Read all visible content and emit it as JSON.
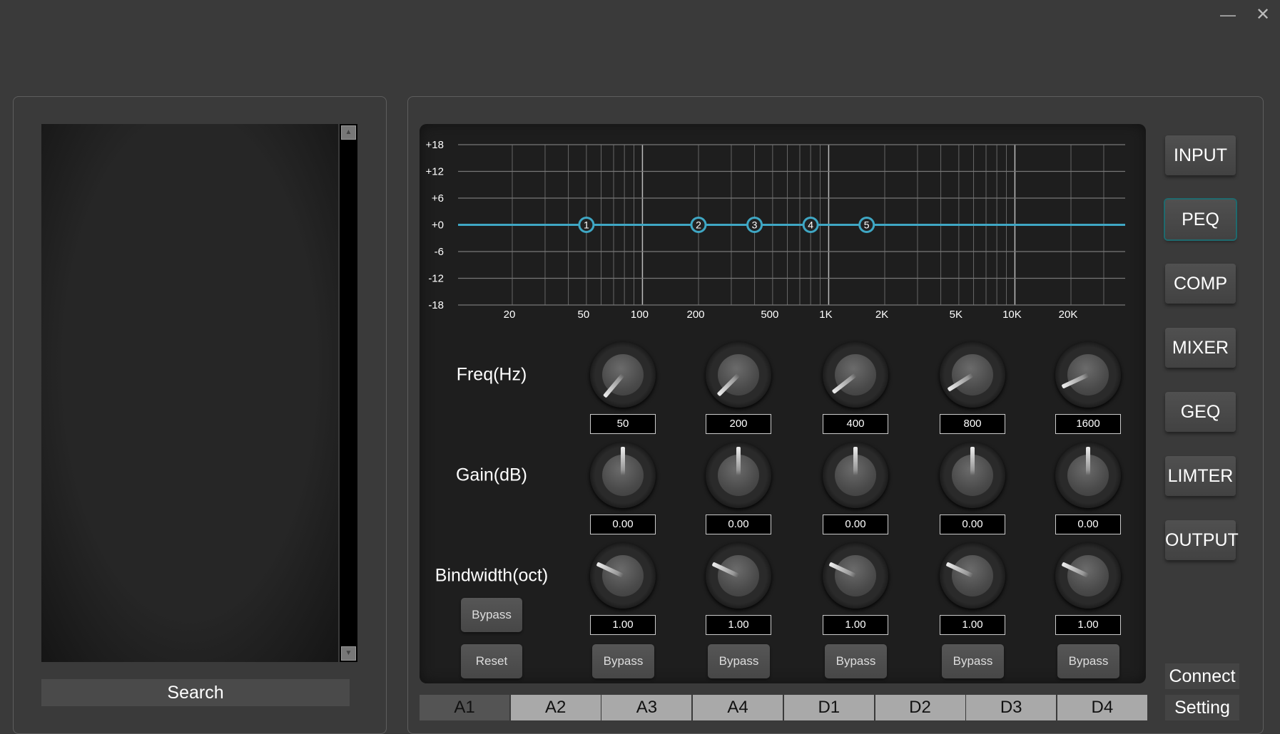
{
  "window": {
    "minimize_icon": "minimize-icon",
    "close_icon": "close-icon"
  },
  "left": {
    "search_label": "Search"
  },
  "eq": {
    "row_labels": {
      "freq": "Freq(Hz)",
      "gain": "Gain(dB)",
      "bandwidth": "Bindwidth(oct)"
    },
    "global_bypass": "Bypass",
    "reset": "Reset",
    "bands": [
      {
        "freq": "50",
        "gain": "0.00",
        "bw": "1.00",
        "bypass": "Bypass"
      },
      {
        "freq": "200",
        "gain": "0.00",
        "bw": "1.00",
        "bypass": "Bypass"
      },
      {
        "freq": "400",
        "gain": "0.00",
        "bw": "1.00",
        "bypass": "Bypass"
      },
      {
        "freq": "800",
        "gain": "0.00",
        "bw": "1.00",
        "bypass": "Bypass"
      },
      {
        "freq": "1600",
        "gain": "0.00",
        "bw": "1.00",
        "bypass": "Bypass"
      }
    ]
  },
  "nav": [
    {
      "label": "INPUT"
    },
    {
      "label": "PEQ",
      "active": true
    },
    {
      "label": "COMP"
    },
    {
      "label": "MIXER"
    },
    {
      "label": "GEQ"
    },
    {
      "label": "LIMTER"
    },
    {
      "label": "OUTPUT"
    }
  ],
  "footer": {
    "connect": "Connect",
    "setting": "Setting"
  },
  "channels": [
    {
      "label": "A1",
      "active": true
    },
    {
      "label": "A2"
    },
    {
      "label": "A3"
    },
    {
      "label": "A4"
    },
    {
      "label": "D1"
    },
    {
      "label": "D2"
    },
    {
      "label": "D3"
    },
    {
      "label": "D4"
    }
  ],
  "colors": {
    "curve": "#3fa7c4",
    "grid": "#777777",
    "accent": "#1f6a6e"
  },
  "chart_data": {
    "type": "line",
    "xscale": "log",
    "x_tick_labels": [
      "20",
      "50",
      "100",
      "200",
      "500",
      "1K",
      "2K",
      "5K",
      "10K",
      "20K"
    ],
    "x_ticks": [
      20,
      50,
      100,
      200,
      500,
      1000,
      2000,
      5000,
      10000,
      20000
    ],
    "y_tick_labels": [
      "+18",
      "+12",
      "+6",
      "+0",
      "-6",
      "-12",
      "-18"
    ],
    "ylim": [
      -18,
      18
    ],
    "grid": true,
    "series": [
      {
        "x": [
          20,
          20000
        ],
        "y": [
          0,
          0
        ]
      }
    ],
    "points": [
      {
        "label": "1",
        "freq": 50,
        "gain": 0
      },
      {
        "label": "2",
        "freq": 200,
        "gain": 0
      },
      {
        "label": "3",
        "freq": 400,
        "gain": 0
      },
      {
        "label": "4",
        "freq": 800,
        "gain": 0
      },
      {
        "label": "5",
        "freq": 1600,
        "gain": 0
      }
    ]
  }
}
